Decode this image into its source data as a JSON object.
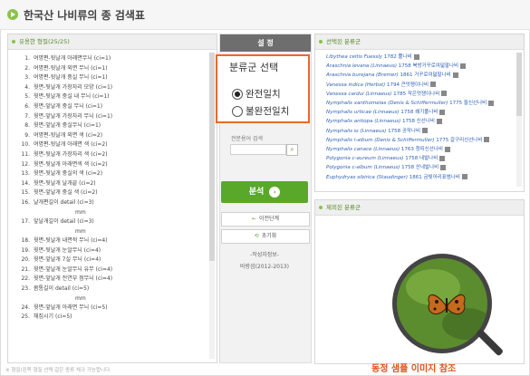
{
  "header": {
    "title": "한국산 나비류의 종 검색표"
  },
  "left_panel": {
    "heading": "유용한 형질(25/25)",
    "traits": [
      {
        "num": "1.",
        "label": "여명편-뒷날개 아래면무늬 (ci=1)"
      },
      {
        "num": "2.",
        "label": "여명편-뒷날개 외면 무늬 (ci=1)"
      },
      {
        "num": "3.",
        "label": "여명편-뒷날개 중실 무늬 (ci=1)"
      },
      {
        "num": "4.",
        "label": "윗면-뒷날개 가장자리 모양 (ci=1)"
      },
      {
        "num": "5.",
        "label": "윗면-뒷날개 중실 내 무늬 (ci=1)"
      },
      {
        "num": "6.",
        "label": "윗면-앞날개 중실 무늬 (ci=1)"
      },
      {
        "num": "7.",
        "label": "윗면-앞날개 가장자리 무늬 (ci=1)"
      },
      {
        "num": "8.",
        "label": "윗면-앞날개 중실무늬 (ci=1)"
      },
      {
        "num": "9.",
        "label": "여명편-뒷날개 외면 색 (ci=2)"
      },
      {
        "num": "10.",
        "label": "여명편-뒷날개 아래면 색 (ci=2)"
      },
      {
        "num": "11.",
        "label": "윗면-뒷날개 가장자리 색 (ci=2)"
      },
      {
        "num": "12.",
        "label": "윗면-뒷날개 아래면색 색 (ci=2)"
      },
      {
        "num": "13.",
        "label": "윗면-뒷날개 중실의 색 (ci=2)"
      },
      {
        "num": "14.",
        "label": "윗면-뒷날개 날개끝 (ci=2)"
      },
      {
        "num": "15.",
        "label": "윗면-앞날개 중실 색 (ci=2)"
      },
      {
        "num": "16.",
        "label": "날개편길이 detail  (ci=3)",
        "unit": "mm"
      },
      {
        "num": "17.",
        "label": "앞날개길이 detail  (ci=3)",
        "unit": "mm"
      },
      {
        "num": "18.",
        "label": "윗면-뒷날개 내면적 무늬 (ci=4)"
      },
      {
        "num": "19.",
        "label": "윗면-뒷날개 눈알무늬 (ci=4)"
      },
      {
        "num": "20.",
        "label": "윗면-앞날개 7실 무늬 (ci=4)"
      },
      {
        "num": "21.",
        "label": "윗면-앞날개 눈알무늬 유무 (ci=4)"
      },
      {
        "num": "22.",
        "label": "윗면-앞날개 전연부 점무늬 (ci=4)"
      },
      {
        "num": "23.",
        "label": "몸통길이 detail  (ci=5)",
        "unit": "mm"
      },
      {
        "num": "24.",
        "label": "윗면-앞날개 아래면 무늬 (ci=5)"
      },
      {
        "num": "25.",
        "label": "채집시기 (ci=5)"
      }
    ],
    "footnote": "※ 형질(왼쪽 형질 선택 갈은 종류 체크 가능합니다."
  },
  "middle": {
    "setting_label": "설 정",
    "selection_title": "분류군 선택",
    "options": [
      {
        "label": "완전일치",
        "checked": true
      },
      {
        "label": "불완전일치",
        "checked": false
      }
    ],
    "search_label": "전문용어 검색",
    "search_value": "",
    "analyze_label": "분석",
    "prev_label": "이전단계",
    "reset_label": "초기화",
    "author_label": "-작성자정보-",
    "author_name": "바랑섬(2012-2013)"
  },
  "right_top": {
    "heading": "선택된 분류군",
    "species": [
      {
        "sci": "Libythea celtis Fuessly",
        "rest": " 1782 뿔나비"
      },
      {
        "sci": "Araschnia levana (Linnaeus)",
        "rest": " 1758 북방거꾸로여덟팔나비"
      },
      {
        "sci": "Araschnia burejana (Bremer)",
        "rest": " 1861 거꾸로여덟팔나비"
      },
      {
        "sci": "Vanessa indica (Herbst)",
        "rest": " 1794 큰멋쟁이나비"
      },
      {
        "sci": "Vanessa cardui (Linnaeus)",
        "rest": " 1785 작은멋쟁이나비"
      },
      {
        "sci": "Nymphalis xanthomelas (Denis & Schiffermuller)",
        "rest": " 1775 들신선나비"
      },
      {
        "sci": "Nymphalis urticae (Linnaeus)",
        "rest": " 1758 쐐기풀나비"
      },
      {
        "sci": "Nymphalis antiopa (Linnaeus)",
        "rest": " 1758 신선나비"
      },
      {
        "sci": "Nymphalis io (Linnaeus)",
        "rest": " 1758 공작나비"
      },
      {
        "sci": "Nymphalis l-album (Denis & Schiffermuller)",
        "rest": " 1775 갈구리신선나비"
      },
      {
        "sci": "Nymphalis canace (Linnaeus)",
        "rest": " 1763 청띠신선나비"
      },
      {
        "sci": "Polygonia c-aureum (Linnaeus)",
        "rest": " 1758 네발나비"
      },
      {
        "sci": "Polygonia c-album (Linnaeus)",
        "rest": " 1758 산네발나비"
      },
      {
        "sci": "Euphydryas sibirica (Staudinger)",
        "rest": " 1861 금빛어리표범나비"
      }
    ]
  },
  "right_bottom": {
    "heading": "제외된 분류군"
  },
  "caption": "동정 샘플 이미지 참조",
  "colors": {
    "accent_green": "#5aa82a",
    "highlight_orange": "#e86a2a",
    "link_blue": "#2d5fb5"
  }
}
